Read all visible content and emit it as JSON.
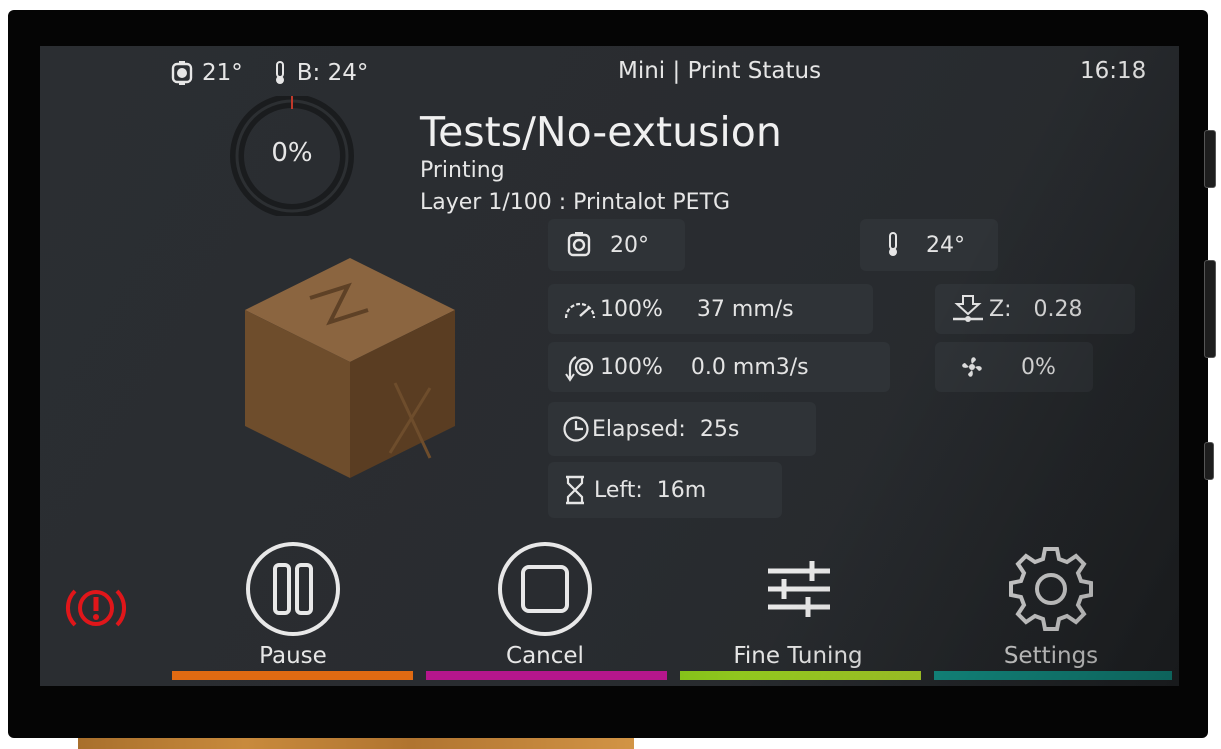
{
  "header": {
    "hotend_temp": "21°",
    "bed_temp": "B: 24°",
    "title": "Mini | Print Status",
    "time": "16:18"
  },
  "progress": {
    "label": "0%",
    "value": 0
  },
  "job": {
    "name": "Tests/No-extusion",
    "state": "Printing",
    "layer_info": "Layer 1/100 : Printalot PETG"
  },
  "stats": {
    "hotend_temp": "20°",
    "bed_temp": "24°",
    "speed_percent": "100%",
    "speed": "37 mm/s",
    "z_label": "Z:",
    "z_value": "0.28",
    "flow_percent": "100%",
    "flow": "0.0 mm3/s",
    "fan": "0%",
    "elapsed": "Elapsed:  25s",
    "left": "Left:  16m"
  },
  "buttons": {
    "pause": "Pause",
    "cancel": "Cancel",
    "fine_tuning": "Fine Tuning",
    "settings": "Settings"
  },
  "colors": {
    "pause_bar": "#e06a12",
    "cancel_bar": "#b5168c",
    "fine_tuning_bar": "#86c11a",
    "settings_bar": "#14958a",
    "alert": "#e0161a"
  },
  "icons": {
    "alert": "alert-circle-icon",
    "hotend": "nozzle-icon",
    "bed": "thermometer-icon",
    "speed": "speedometer-icon",
    "z": "z-offset-icon",
    "flow": "flow-icon",
    "fan": "fan-icon",
    "elapsed": "clock-icon",
    "left": "hourglass-icon"
  }
}
